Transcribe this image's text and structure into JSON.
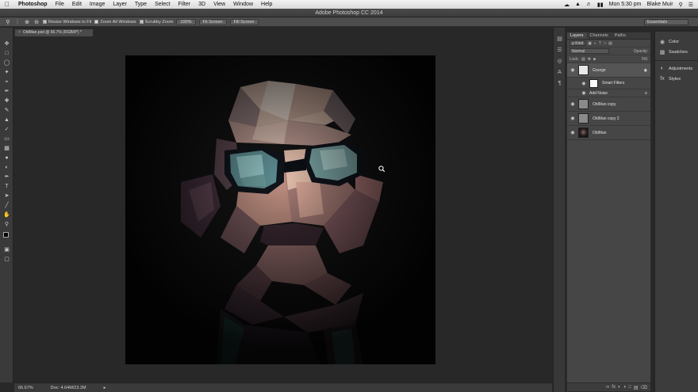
{
  "menubar": {
    "app": "Photoshop",
    "items": [
      "File",
      "Edit",
      "Image",
      "Layer",
      "Type",
      "Select",
      "Filter",
      "3D",
      "View",
      "Window",
      "Help"
    ],
    "clock": "Mon 5:30 pm",
    "user": "Blake Muir"
  },
  "window": {
    "title": "Adobe Photoshop CC 2014"
  },
  "options": {
    "resize_windows": "Resize Windows to Fit",
    "zoom_all": "Zoom All Windows",
    "scrubby_zoom": "Scrubby Zoom",
    "btn_100": "100%",
    "btn_fit": "Fit Screen",
    "btn_fill": "Fill Screen",
    "workspace": "Essentials"
  },
  "document": {
    "tab": "OldMan.psd @ 66.7% (RGB/8*) *"
  },
  "status": {
    "zoom": "66.67%",
    "doc_size": "Doc: 4.64M/23.2M"
  },
  "layers_panel": {
    "tabs": [
      "Layers",
      "Channels",
      "Paths"
    ],
    "filter_kind": "ρ Kind",
    "blend_mode": "Normal",
    "opacity_label": "Opacity:",
    "lock_label": "Lock:",
    "fill_label": "Fill:",
    "layers": [
      {
        "name": "Grunge"
      },
      {
        "name": "Smart Filters"
      },
      {
        "name": "Add Noise"
      },
      {
        "name": "OldMan copy"
      },
      {
        "name": "OldMan copy 2"
      },
      {
        "name": "OldMan"
      }
    ]
  },
  "right_panels": {
    "items": [
      "Color",
      "Swatches",
      "Adjustments",
      "Styles"
    ]
  },
  "icons": {
    "apple": "apple-icon",
    "zoom": "zoom-tool-icon",
    "eye": "eye-icon"
  }
}
